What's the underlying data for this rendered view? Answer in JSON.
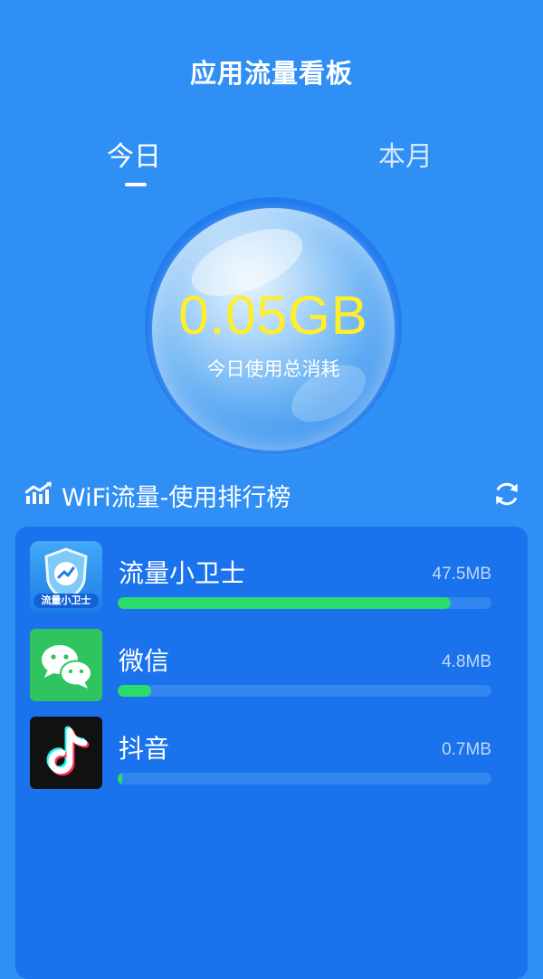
{
  "header": {
    "title": "应用流量看板"
  },
  "tabs": [
    {
      "label": "今日",
      "active": true
    },
    {
      "label": "本月",
      "active": false
    }
  ],
  "summary": {
    "value": "0.05GB",
    "caption": "今日使用总消耗"
  },
  "ranking": {
    "title": "WiFi流量-使用排行榜",
    "icons": {
      "title_icon": "trend-chart-icon",
      "refresh_icon": "refresh-icon"
    },
    "apps": [
      {
        "name": "流量小卫士",
        "usage": "47.5MB",
        "progress": 0.89,
        "icon": "traffic-guard-app-icon",
        "icon_text": "流量小卫士"
      },
      {
        "name": "微信",
        "usage": "4.8MB",
        "progress": 0.09,
        "icon": "wechat-app-icon"
      },
      {
        "name": "抖音",
        "usage": "0.7MB",
        "progress": 0.012,
        "icon": "douyin-app-icon"
      }
    ]
  },
  "colors": {
    "background": "#2f8ff5",
    "panel": "#1a73ec",
    "progress_fill": "#2bdc6b",
    "progress_track": "#3385ef",
    "value_text": "#ffef2a"
  }
}
